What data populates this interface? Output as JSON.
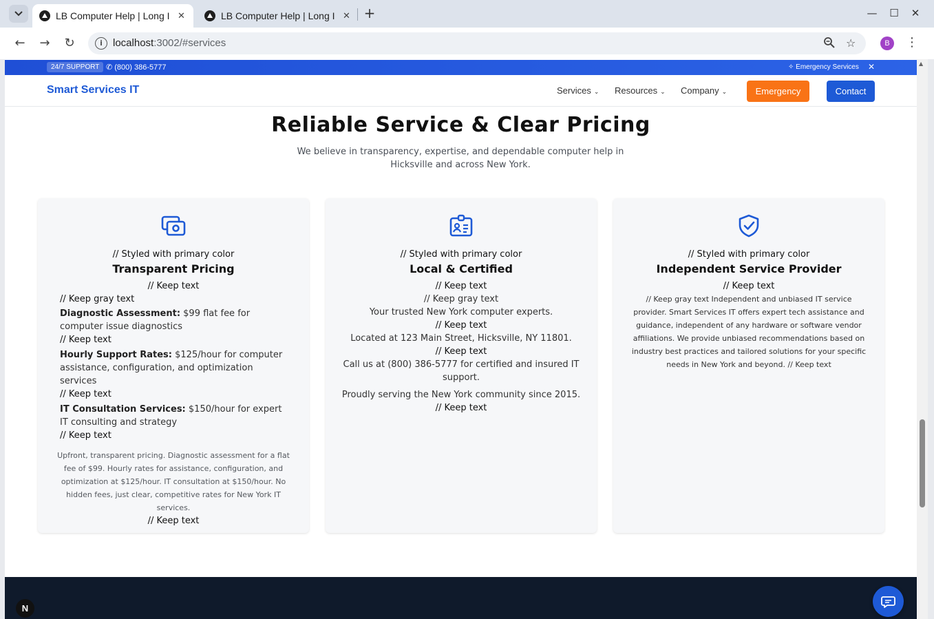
{
  "browser": {
    "tabs": [
      {
        "title": "LB Computer Help | Long Island",
        "active": true
      },
      {
        "title": "LB Computer Help | Long Island",
        "active": false
      }
    ],
    "new_tab": "+",
    "url_host": "localhost",
    "url_rest": ":3002/#services",
    "profile_initial": "B"
  },
  "topbar": {
    "badge": "24/7 SUPPORT",
    "phone": "✆ (800) 386-5777",
    "emergency": "✧ Emergency Services",
    "close": "✕"
  },
  "header": {
    "brand": "Smart Services IT",
    "nav": [
      {
        "label": "Services"
      },
      {
        "label": "Resources"
      },
      {
        "label": "Company"
      }
    ],
    "emergency_label": "Emergency",
    "contact_label": "Contact"
  },
  "section": {
    "title": "Reliable Service & Clear Pricing",
    "subtitle": "We believe in transparency, expertise, and dependable computer help in Hicksville and across New York."
  },
  "cards": [
    {
      "icon": "camera-icon",
      "note_primary": "// Styled with primary color",
      "title": "Transparent Pricing",
      "note_keep": "// Keep text",
      "note_gray": "// Keep gray text",
      "items": [
        {
          "label": "Diagnostic Assessment:",
          "text": "$99 flat fee for computer issue diagnostics",
          "note": "// Keep text"
        },
        {
          "label": "Hourly Support Rates:",
          "text": "$125/hour for computer assistance, configuration, and optimization services",
          "note": "// Keep text"
        },
        {
          "label": "IT Consultation Services:",
          "text": "$150/hour for expert IT consulting and strategy",
          "note": "// Keep text"
        }
      ],
      "summary": "Upfront, transparent pricing. Diagnostic assessment for a flat fee of $99. Hourly rates for assistance, configuration, and optimization at $125/hour. IT consultation at $150/hour. No hidden fees, just clear, competitive rates for New York IT services.",
      "note_end": "// Keep text"
    },
    {
      "icon": "id-card-icon",
      "note_primary": "// Styled with primary color",
      "title": "Local & Certified",
      "note_keep": "// Keep text",
      "note_gray": "// Keep gray text",
      "line1": "Your trusted New York computer experts.",
      "line1_note": "// Keep text",
      "line2": "Located at 123 Main Street, Hicksville, NY 11801.",
      "line2_note": "// Keep text",
      "line3": "Call us at (800) 386-5777 for certified and insured IT support.",
      "line4": "Proudly serving the New York community since 2015.",
      "line4_note": "// Keep text"
    },
    {
      "icon": "shield-check-icon",
      "note_primary": "// Styled with primary color",
      "title": "Independent Service Provider",
      "note_keep": "// Keep text",
      "body": "// Keep gray text Independent and unbiased IT service provider. Smart Services IT offers expert tech assistance and guidance, independent of any hardware or software vendor affiliations. We provide unbiased recommendations based on industry best practices and tailored solutions for your specific needs in New York and beyond. // Keep text"
    }
  ],
  "misc": {
    "next_badge": "N"
  },
  "colors": {
    "primary": "#1e5ad6",
    "emergency": "#f97316",
    "footer": "#0f1a2b"
  }
}
